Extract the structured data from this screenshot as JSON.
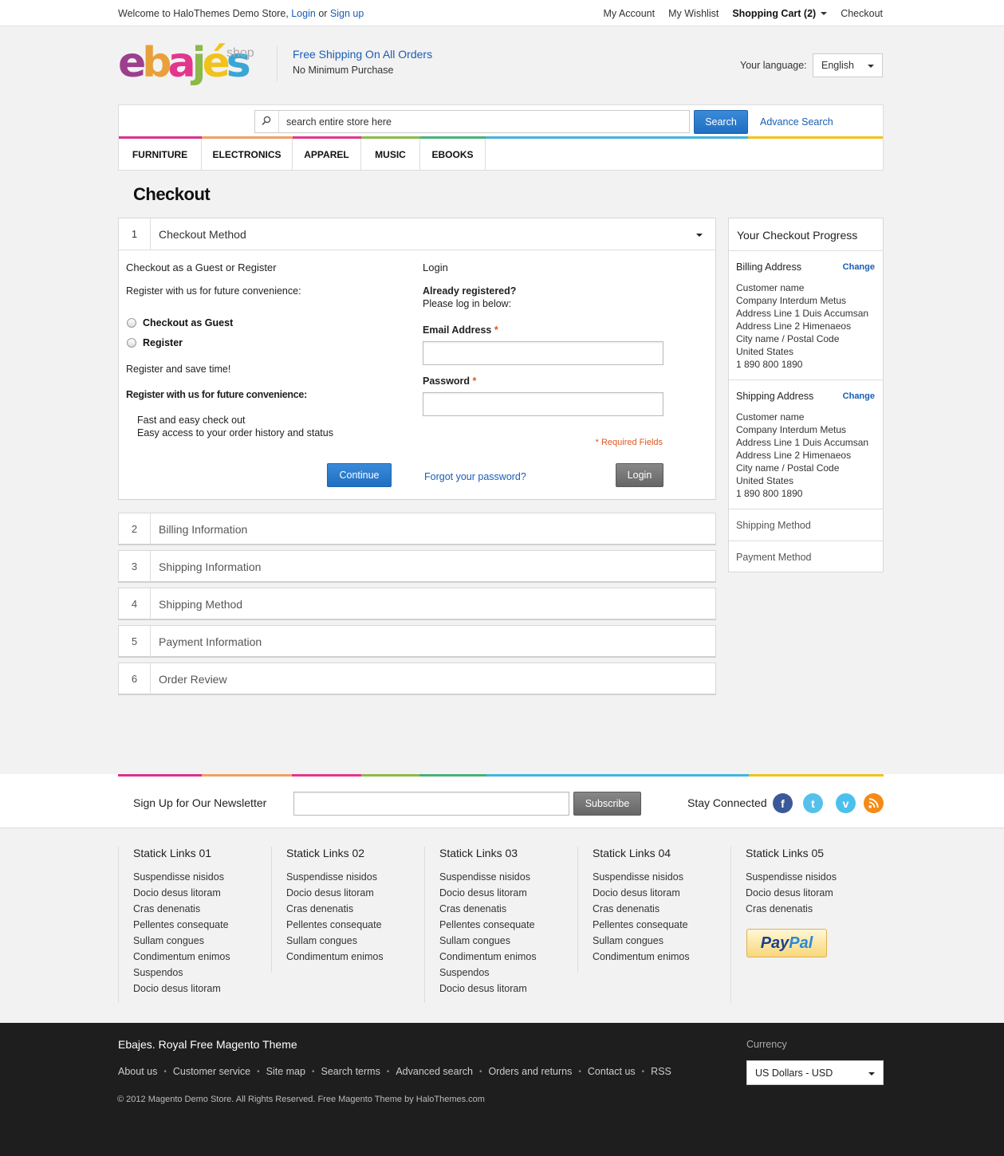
{
  "topbar": {
    "welcome": "Welcome to HaloThemes Demo Store,",
    "login": "Login",
    "or": "or",
    "signup": "Sign up",
    "links": [
      "My Account",
      "My Wishlist"
    ],
    "cart": "Shopping Cart (2)",
    "checkout": "Checkout"
  },
  "header": {
    "logo_word": [
      "e",
      "b",
      "a",
      "j",
      "é",
      "s"
    ],
    "logo_suffix": "shop",
    "promo_title": "Free Shipping On All Orders",
    "promo_sub": "No Minimum Purchase",
    "language_label": "Your language:",
    "language_value": "English"
  },
  "search": {
    "placeholder": "search entire store here",
    "button": "Search",
    "advanced": "Advance Search"
  },
  "menu": [
    "FURNITURE",
    "ELECTRONICS",
    "APPAREL",
    "MUSIC",
    "EBOOKS"
  ],
  "colors": {
    "accent_blue": "#1a5db4",
    "bar": [
      "#e4358e",
      "#f0a060",
      "#d9318e",
      "#8cb94a",
      "#49b079",
      "#42b3df",
      "#f1c21b"
    ]
  },
  "page_title": "Checkout",
  "step1": {
    "num": "1",
    "title": "Checkout Method",
    "left_heading": "Checkout as a Guest or Register",
    "left_sub": "Register with us for future convenience:",
    "radio_guest": "Checkout as Guest",
    "radio_register": "Register",
    "save_time": "Register and save time!",
    "benefits_heading": "Register with us for future convenience:",
    "benefits": [
      "Fast and easy check out",
      "Easy access to your order history and status"
    ],
    "continue": "Continue",
    "login_heading": "Login",
    "already": "Already registered?",
    "please": "Please log in below:",
    "email_label": "Email Address",
    "password_label": "Password",
    "asterisk": "*",
    "required": "* Required Fields",
    "forgot": "Forgot your password?",
    "login_button": "Login"
  },
  "steps": [
    {
      "num": "2",
      "title": "Billing Information"
    },
    {
      "num": "3",
      "title": "Shipping Information"
    },
    {
      "num": "4",
      "title": "Shipping Method"
    },
    {
      "num": "5",
      "title": "Payment Information"
    },
    {
      "num": "6",
      "title": "Order Review"
    }
  ],
  "progress": {
    "title": "Your Checkout Progress",
    "change": "Change",
    "billing": {
      "heading": "Billing Address",
      "lines": [
        "Customer name",
        "Company Interdum Metus",
        "Address Line 1 Duis Accumsan",
        "Address Line 2 Himenaeos",
        "City name / Postal Code",
        "United States",
        "1 890 800 1890"
      ]
    },
    "shipping": {
      "heading": "Shipping Address",
      "lines": [
        "Customer name",
        "Company Interdum Metus",
        "Address Line 1 Duis Accumsan",
        "Address Line 2 Himenaeos",
        "City name / Postal Code",
        "United States",
        "1 890 800 1890"
      ]
    },
    "shipping_method": "Shipping Method",
    "payment_method": "Payment Method"
  },
  "newsletter": {
    "label": "Sign Up for Our Newsletter",
    "button": "Subscribe",
    "stay": "Stay Connected",
    "social_icons": [
      "facebook-icon",
      "twitter-icon",
      "vimeo-icon",
      "rss-icon"
    ]
  },
  "static_links": [
    {
      "title": "Statick Links 01",
      "items": [
        "Suspendisse nisidos",
        "Docio desus litoram",
        "Cras denenatis",
        "Pellentes consequate",
        "Sullam congues",
        "Condimentum enimos",
        "Suspendos",
        "Docio desus litoram"
      ]
    },
    {
      "title": "Statick Links 02",
      "items": [
        "Suspendisse nisidos",
        "Docio desus litoram",
        "Cras denenatis",
        "Pellentes consequate",
        "Sullam congues",
        "Condimentum enimos"
      ]
    },
    {
      "title": "Statick Links 03",
      "items": [
        "Suspendisse nisidos",
        "Docio desus litoram",
        "Cras denenatis",
        "Pellentes consequate",
        "Sullam congues",
        "Condimentum enimos",
        "Suspendos",
        "Docio desus litoram"
      ]
    },
    {
      "title": "Statick Links 04",
      "items": [
        "Suspendisse nisidos",
        "Docio desus litoram",
        "Cras denenatis",
        "Pellentes consequate",
        "Sullam congues",
        "Condimentum enimos"
      ]
    },
    {
      "title": "Statick Links 05",
      "items": [
        "Suspendisse nisidos",
        "Docio desus litoram",
        "Cras denenatis"
      ]
    }
  ],
  "paypal": {
    "p1": "Pay",
    "p2": "Pal"
  },
  "footer": {
    "title": "Ebajes. Royal Free Magento Theme",
    "links": [
      "About us",
      "Customer service",
      "Site map",
      "Search terms",
      "Advanced search",
      "Orders and returns",
      "Contact us",
      "RSS"
    ],
    "separator": "•",
    "copyright": "© 2012 Magento Demo Store. All Rights Reserved. Free Magento Theme by HaloThemes.com",
    "currency_label": "Currency",
    "currency_value": "US Dollars - USD"
  }
}
